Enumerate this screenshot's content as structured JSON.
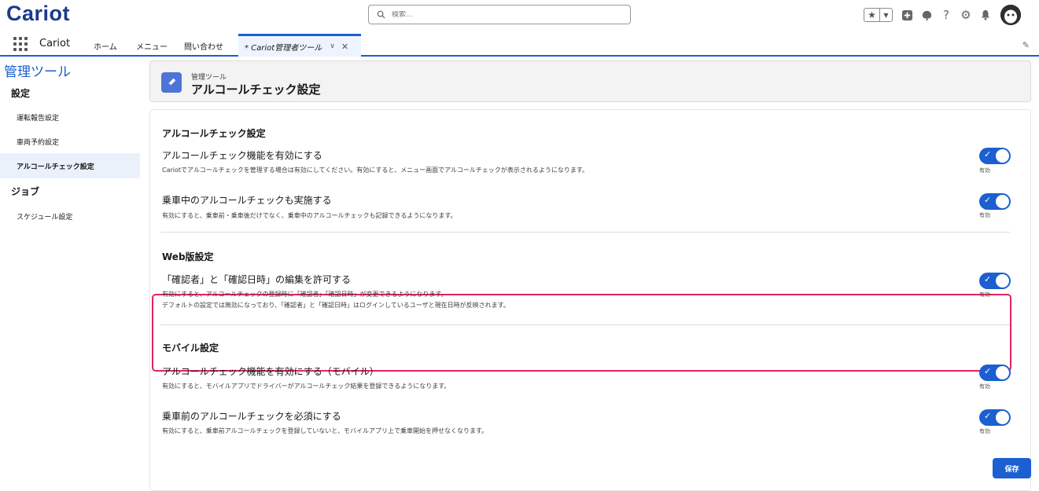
{
  "header": {
    "logo_text": "Cariot",
    "search_placeholder": "検索..."
  },
  "nav": {
    "app_name": "Cariot",
    "items": [
      "ホーム",
      "メニュー",
      "問い合わせ"
    ],
    "active_tab": "* Cariot管理者ツール"
  },
  "sidebar": {
    "title": "管理ツール",
    "section1": "設定",
    "items1": [
      "運転報告設定",
      "車両予約設定",
      "アルコールチェック設定"
    ],
    "section2": "ジョブ",
    "items2": [
      "スケジュール設定"
    ]
  },
  "page": {
    "subtitle": "管理ツール",
    "title": "アルコールチェック設定"
  },
  "sections": [
    {
      "title": "アルコールチェック設定",
      "settings": [
        {
          "label": "アルコールチェック機能を有効にする",
          "desc": "Cariotでアルコールチェックを管理する場合は有効にしてください。有効にすると、メニュー画面でアルコールチェックが表示されるようになります。",
          "state": "有効"
        },
        {
          "label": "乗車中のアルコールチェックも実施する",
          "desc": "有効にすると、乗車前・乗車後だけでなく、乗車中のアルコールチェックも記録できるようになります。",
          "state": "有効"
        }
      ]
    },
    {
      "title": "Web版設定",
      "settings": [
        {
          "label": "「確認者」と「確認日時」の編集を許可する",
          "desc": "有効にすると、アルコールチェックの登録時に「確認者」「確認日時」が変更できるようになります。",
          "desc2": "デフォルトの設定では無効になっており、「確認者」と「確認日時」はログインしているユーザと現在日時が反映されます。",
          "state": "有効"
        }
      ]
    },
    {
      "title": "モバイル設定",
      "settings": [
        {
          "label": "アルコールチェック機能を有効にする（モバイル）",
          "desc": "有効にすると、モバイルアプリでドライバーがアルコールチェック結果を登録できるようになります。",
          "state": "有効"
        },
        {
          "label": "乗車前のアルコールチェックを必須にする",
          "desc": "有効にすると、乗車前アルコールチェックを登録していないと、モバイルアプリ上で乗車開始を押せなくなります。",
          "state": "有効"
        }
      ]
    }
  ],
  "save_label": "保存",
  "colors": {
    "brand": "#1b3a8c",
    "accent": "#1b5fd1",
    "highlight": "#e0245e"
  }
}
